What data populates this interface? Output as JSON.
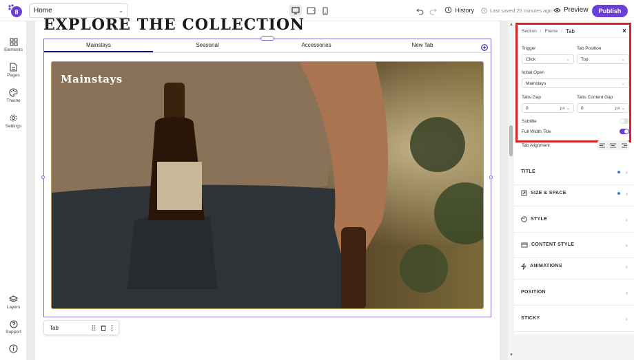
{
  "topbar": {
    "page_selected": "Home",
    "history_label": "History",
    "saved_text": "Last saved 25 minutes ago",
    "preview_label": "Preview",
    "publish_label": "Publish",
    "brand_color": "#6b3fd6"
  },
  "leftbar": {
    "items": [
      {
        "label": "Elements",
        "icon": "grid-icon"
      },
      {
        "label": "Pages",
        "icon": "page-icon"
      },
      {
        "label": "Theme",
        "icon": "palette-icon"
      },
      {
        "label": "Settings",
        "icon": "gear-icon"
      }
    ],
    "bottom_items": [
      {
        "label": "Layers",
        "icon": "layers-icon"
      },
      {
        "label": "Support",
        "icon": "help-icon"
      }
    ]
  },
  "canvas": {
    "heading": "EXPLORE THE COLLECTION",
    "tabs": [
      "Mainstays",
      "Seasonal",
      "Accessories",
      "New Tab"
    ],
    "active_tab": "Mainstays",
    "image_title": "Mainstays",
    "element_toolbar_label": "Tab"
  },
  "panel": {
    "breadcrumb": [
      "Section",
      "Frame",
      "Tab"
    ],
    "trigger_label": "Trigger",
    "trigger_value": "Click",
    "tab_position_label": "Tab Position",
    "tab_position_value": "Top",
    "initial_open_label": "Initial Open",
    "initial_open_value": "Mainstays",
    "tabs_gap_label": "Tabs Gap",
    "tabs_gap_value": "0",
    "tabs_gap_unit": "px",
    "tabs_content_gap_label": "Tabs Content Gap",
    "tabs_content_gap_value": "0",
    "tabs_content_gap_unit": "px",
    "subtitle_label": "Subtitle",
    "subtitle_on": false,
    "full_width_title_label": "Full Width Title",
    "full_width_title_on": true,
    "tab_alignment_label": "Tab Alignment",
    "sections": [
      "TITLE",
      "SIZE & SPACE",
      "STYLE",
      "CONTENT STYLE",
      "ANIMATIONS",
      "POSITION",
      "STICKY"
    ],
    "highlight_color": "#d62424"
  }
}
